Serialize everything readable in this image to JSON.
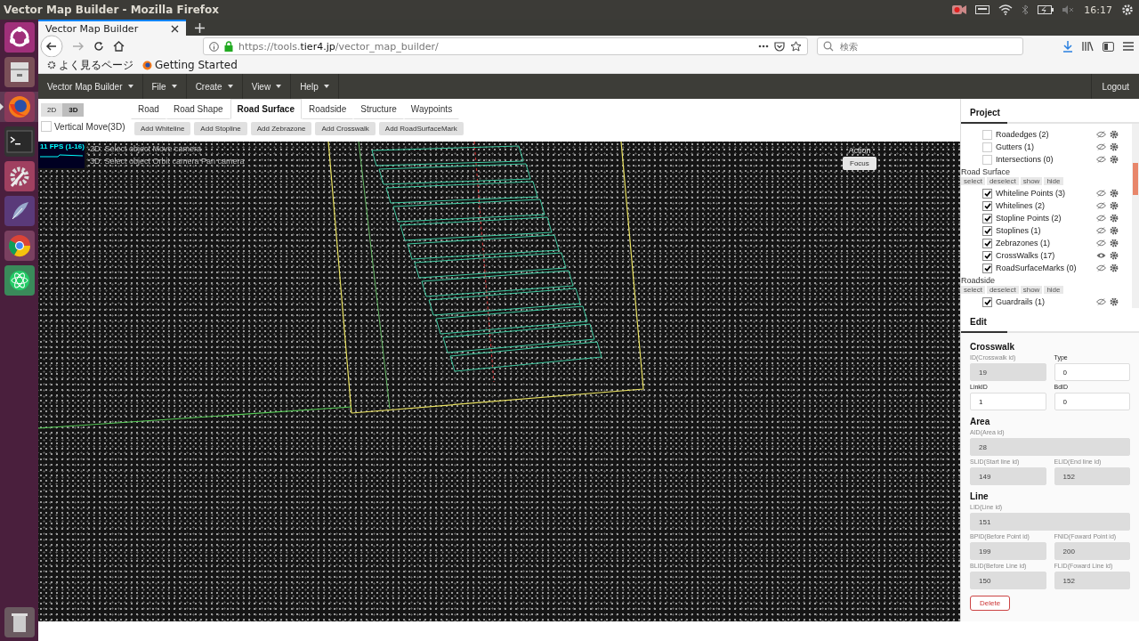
{
  "system_bar": {
    "window_title": "Vector Map Builder - Mozilla Firefox",
    "clock": "16:17"
  },
  "launcher": [
    {
      "kind": "ubuntu",
      "selected": false
    },
    {
      "kind": "files",
      "selected": false
    },
    {
      "kind": "firefox",
      "selected": true
    },
    {
      "kind": "terminal",
      "selected": false
    },
    {
      "kind": "settings",
      "selected": false
    },
    {
      "kind": "editor",
      "selected": false
    },
    {
      "kind": "chrome",
      "selected": false
    },
    {
      "kind": "atom",
      "selected": false
    },
    {
      "kind": "trash",
      "selected": false
    }
  ],
  "browser": {
    "tab_title": "Vector Map Builder",
    "url": {
      "prefix": "https://tools.",
      "domain": "tier4.jp",
      "path": "/vector_map_builder/"
    },
    "search": {
      "placeholder": "検索"
    },
    "bookmarks": [
      "よく見るページ",
      "Getting Started"
    ]
  },
  "menu": [
    "Vector Map Builder",
    "File",
    "Create",
    "View",
    "Help"
  ],
  "logout": "Logout",
  "view_modes": [
    {
      "label": "2D",
      "selected": false
    },
    {
      "label": "3D",
      "selected": true
    }
  ],
  "vertical_move": {
    "label": "Vertical Move(3D)",
    "checked": false
  },
  "tabs": [
    {
      "label": "Road",
      "selected": false
    },
    {
      "label": "Road Shape",
      "selected": false
    },
    {
      "label": "Road Surface",
      "selected": true
    },
    {
      "label": "Roadside",
      "selected": false
    },
    {
      "label": "Structure",
      "selected": false
    },
    {
      "label": "Waypoints",
      "selected": false
    }
  ],
  "actions": [
    "Add Whiteline",
    "Add Stopline",
    "Add Zebrazone",
    "Add Crosswalk",
    "Add RoadSurfaceMark"
  ],
  "viewport": {
    "fps": "11 FPS (1-16)",
    "hints": [
      "2D: Select object Move camera",
      "3D: Select object Orbit camera Pan camera"
    ],
    "action_label": "Action",
    "focus_button": "Focus"
  },
  "project": {
    "title": "Project",
    "groups": [
      {
        "layers": [
          {
            "label": "Roadedges (2)",
            "checked": false,
            "visible": false
          },
          {
            "label": "Gutters (1)",
            "checked": false,
            "visible": false
          },
          {
            "label": "Intersections (0)",
            "checked": false,
            "visible": false
          }
        ]
      },
      {
        "title": "Road Surface",
        "buttons": [
          "select",
          "deselect",
          "show",
          "hide"
        ],
        "layers": [
          {
            "label": "Whiteline Points (3)",
            "checked": true,
            "visible": false
          },
          {
            "label": "Whitelines (2)",
            "checked": true,
            "visible": false
          },
          {
            "label": "Stopline Points (2)",
            "checked": true,
            "visible": false
          },
          {
            "label": "Stoplines (1)",
            "checked": true,
            "visible": false
          },
          {
            "label": "Zebrazones (1)",
            "checked": true,
            "visible": false
          },
          {
            "label": "CrossWalks (17)",
            "checked": true,
            "visible": true
          },
          {
            "label": "RoadSurfaceMarks (0)",
            "checked": true,
            "visible": false
          }
        ]
      },
      {
        "title": "Roadside",
        "buttons": [
          "select",
          "deselect",
          "show",
          "hide"
        ],
        "layers": [
          {
            "label": "Guardrails (1)",
            "checked": true,
            "visible": false
          }
        ]
      }
    ]
  },
  "edit": {
    "title": "Edit",
    "sections": [
      {
        "title": "Crosswalk",
        "rows": [
          [
            {
              "label": "ID(Crosswalk id)",
              "value": "19",
              "disabled": true
            },
            {
              "label": "Type",
              "value": "0",
              "disabled": false
            }
          ],
          [
            {
              "label": "LinkID",
              "value": "1",
              "disabled": false
            },
            {
              "label": "BdID",
              "value": "0",
              "disabled": false
            }
          ]
        ]
      },
      {
        "title": "Area",
        "rows": [
          [
            {
              "label": "AID(Area id)",
              "value": "28",
              "disabled": true
            }
          ],
          [
            {
              "label": "SLID(Start line id)",
              "value": "149",
              "disabled": true
            },
            {
              "label": "ELID(End line id)",
              "value": "152",
              "disabled": true
            }
          ]
        ]
      },
      {
        "title": "Line",
        "rows": [
          [
            {
              "label": "LID(Line id)",
              "value": "151",
              "disabled": true
            }
          ],
          [
            {
              "label": "BPID(Before Point id)",
              "value": "199",
              "disabled": true
            },
            {
              "label": "FNID(Foward Point id)",
              "value": "200",
              "disabled": true
            }
          ],
          [
            {
              "label": "BLID(Before Line id)",
              "value": "150",
              "disabled": true
            },
            {
              "label": "FLID(Foward Line id)",
              "value": "152",
              "disabled": true
            }
          ]
        ]
      }
    ],
    "delete_button": "Delete"
  }
}
